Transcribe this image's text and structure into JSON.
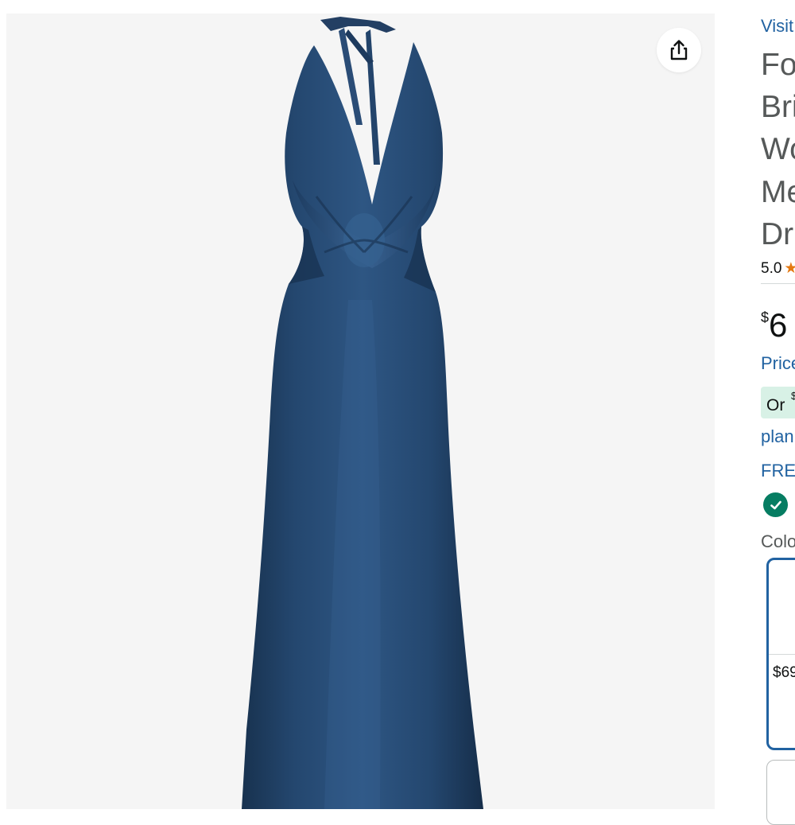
{
  "share": {
    "icon": "share-icon"
  },
  "product_image": {
    "alt": "Navy blue satin halter maxi dress"
  },
  "sidebar": {
    "visit_link": "Visit",
    "title_lines": [
      "Fo",
      "Bri",
      "Wo",
      "Me",
      "Dr"
    ],
    "rating": {
      "value": "5.0",
      "star": "★"
    },
    "price": {
      "symbol": "$",
      "whole": "6"
    },
    "price_link": "Price",
    "or_badge": {
      "text": "Or",
      "sup": "$"
    },
    "plan_link": "plan",
    "free_link": "FREE",
    "check_icon": "check-circle-icon",
    "color_label": "Colo",
    "swatch_price": "$69"
  },
  "colors": {
    "link": "#2162a1",
    "dress": "#1f3f66",
    "badge_bg": "#d8f1e6",
    "check": "#067d62",
    "star": "#e47911"
  }
}
